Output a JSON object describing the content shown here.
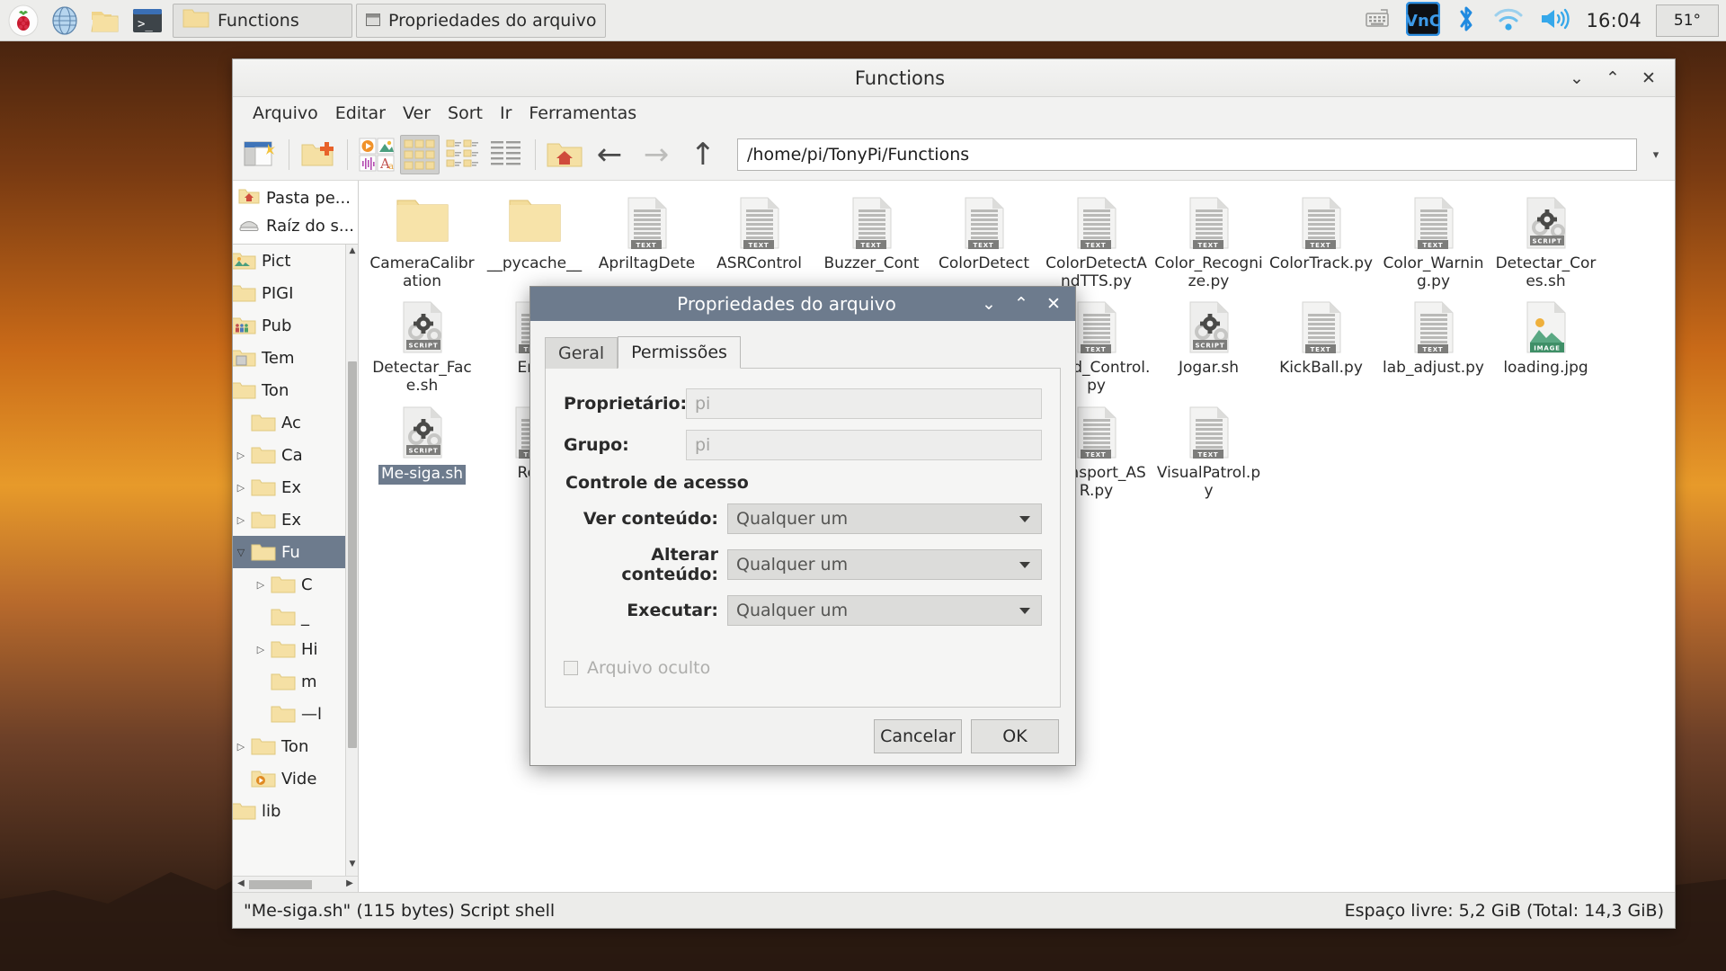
{
  "taskbar": {
    "launchers": [
      {
        "name": "raspberry-menu-icon",
        "label": "Menu"
      },
      {
        "name": "web-browser-icon",
        "label": "Chromium"
      },
      {
        "name": "file-manager-icon",
        "label": "Gerenciador de arquivos"
      },
      {
        "name": "terminal-icon",
        "label": "Terminal"
      }
    ],
    "tasks": [
      {
        "label": "Functions",
        "icon": "folder-icon",
        "active": true
      },
      {
        "label": "Propriedades do arquivo",
        "icon": "window-icon",
        "active": false
      }
    ],
    "tray": {
      "icons": [
        "keyboard-icon",
        "vnc-icon",
        "bluetooth-icon",
        "wifi-icon",
        "volume-icon"
      ],
      "clock": "16:04",
      "temperature": "51°"
    }
  },
  "file_manager": {
    "title": "Functions",
    "menu": [
      "Arquivo",
      "Editar",
      "Ver",
      "Sort",
      "Ir",
      "Ferramentas"
    ],
    "toolbar_icons": [
      "new-window-icon",
      "new-folder-icon",
      "applications-icon",
      "icon-view-icon",
      "compact-view-icon",
      "detailed-list-icon",
      "home-folder-icon"
    ],
    "nav": {
      "back": "back-arrow-icon",
      "forward": "forward-arrow-icon",
      "up": "up-arrow-icon"
    },
    "path": "/home/pi/TonyPi/Functions",
    "places": [
      {
        "label": "Pasta pe...",
        "icon": "home-folder-icon"
      },
      {
        "label": "Raíz do s...",
        "icon": "drive-icon"
      }
    ],
    "tree": [
      {
        "label": "Pict",
        "indent": 1,
        "arrow": "none",
        "icon": "pictures-folder-icon",
        "selected": false
      },
      {
        "label": "PIGI",
        "indent": 1,
        "arrow": "closed",
        "icon": "folder-icon",
        "selected": false
      },
      {
        "label": "Pub",
        "indent": 1,
        "arrow": "none",
        "icon": "public-folder-icon",
        "selected": false
      },
      {
        "label": "Tem",
        "indent": 1,
        "arrow": "none",
        "icon": "templates-folder-icon",
        "selected": false
      },
      {
        "label": "Ton",
        "indent": 1,
        "arrow": "open",
        "icon": "folder-icon",
        "selected": false
      },
      {
        "label": "Ac",
        "indent": 2,
        "arrow": "none",
        "icon": "folder-icon",
        "selected": false
      },
      {
        "label": "Ca",
        "indent": 2,
        "arrow": "closed",
        "icon": "folder-icon",
        "selected": false
      },
      {
        "label": "Ex",
        "indent": 2,
        "arrow": "closed",
        "icon": "folder-icon",
        "selected": false
      },
      {
        "label": "Ex",
        "indent": 2,
        "arrow": "closed",
        "icon": "folder-icon",
        "selected": false
      },
      {
        "label": "Fu",
        "indent": 2,
        "arrow": "open",
        "icon": "folder-icon",
        "selected": true
      },
      {
        "label": "C",
        "indent": 3,
        "arrow": "closed",
        "icon": "folder-icon",
        "selected": false
      },
      {
        "label": "_",
        "indent": 3,
        "arrow": "none",
        "icon": "folder-icon",
        "selected": false
      },
      {
        "label": "Hi",
        "indent": 3,
        "arrow": "closed",
        "icon": "folder-icon",
        "selected": false
      },
      {
        "label": "m",
        "indent": 3,
        "arrow": "none",
        "icon": "folder-icon",
        "selected": false
      },
      {
        "label": "—l",
        "indent": 3,
        "arrow": "none",
        "icon": "folder-icon",
        "selected": false
      },
      {
        "label": "Ton",
        "indent": 2,
        "arrow": "closed",
        "icon": "folder-icon",
        "selected": false
      },
      {
        "label": "Vide",
        "indent": 2,
        "arrow": "none",
        "icon": "videos-folder-icon",
        "selected": false
      },
      {
        "label": "lib",
        "indent": 1,
        "arrow": "closed",
        "icon": "folder-icon",
        "selected": false
      }
    ],
    "items": [
      {
        "name": "CameraCalibration",
        "type": "folder"
      },
      {
        "name": "__pycache__",
        "type": "folder"
      },
      {
        "name": "ApriltagDete",
        "type": "text"
      },
      {
        "name": "ASRControl",
        "type": "text"
      },
      {
        "name": "Buzzer_Cont",
        "type": "text"
      },
      {
        "name": "ColorDetect",
        "type": "text"
      },
      {
        "name": "ColorDetectAndTTS.py",
        "type": "text"
      },
      {
        "name": "Color_Recognize.py",
        "type": "text"
      },
      {
        "name": "ColorTrack.py",
        "type": "text"
      },
      {
        "name": "Color_Warning.py",
        "type": "text"
      },
      {
        "name": "Detectar_Cores.sh",
        "type": "script"
      },
      {
        "name": "Detectar_Face.sh",
        "type": "script"
      },
      {
        "name": "Emp",
        "type": "text"
      },
      {
        "name": "Head_Control.py",
        "type": "text"
      },
      {
        "name": "Jogar.sh",
        "type": "script"
      },
      {
        "name": "KickBall.py",
        "type": "text"
      },
      {
        "name": "lab_adjust.py",
        "type": "text"
      },
      {
        "name": "loading.jpg",
        "type": "image"
      },
      {
        "name": "Me-siga.sh",
        "type": "script",
        "selected": true
      },
      {
        "name": "Rem",
        "type": "text"
      },
      {
        "name": "Transport_ASR.py",
        "type": "text"
      },
      {
        "name": "VisualPatrol.py",
        "type": "text"
      }
    ],
    "status_left": "\"Me-siga.sh\" (115 bytes) Script shell",
    "status_right": "Espaço livre: 5,2 GiB (Total: 14,3 GiB)"
  },
  "dialog": {
    "title": "Propriedades do arquivo",
    "tabs": [
      {
        "label": "Geral",
        "active": false
      },
      {
        "label": "Permissões",
        "active": true
      }
    ],
    "fields": {
      "owner_label": "Proprietário:",
      "owner_value": "pi",
      "group_label": "Grupo:",
      "group_value": "pi"
    },
    "access_section_title": "Controle de acesso",
    "access_rows": [
      {
        "label": "Ver conteúdo:",
        "value": "Qualquer um"
      },
      {
        "label": "Alterar conteúdo:",
        "value": "Qualquer um"
      },
      {
        "label": "Executar:",
        "value": "Qualquer um"
      }
    ],
    "hidden_checkbox": {
      "label": "Arquivo oculto",
      "checked": false
    },
    "buttons": {
      "cancel": "Cancelar",
      "ok": "OK"
    }
  },
  "colors": {
    "title_accent": "#6d7b8d",
    "selection": "#6d7b8d",
    "taskbar_bg": "#ededeb",
    "window_bg": "#f2f2f1"
  }
}
